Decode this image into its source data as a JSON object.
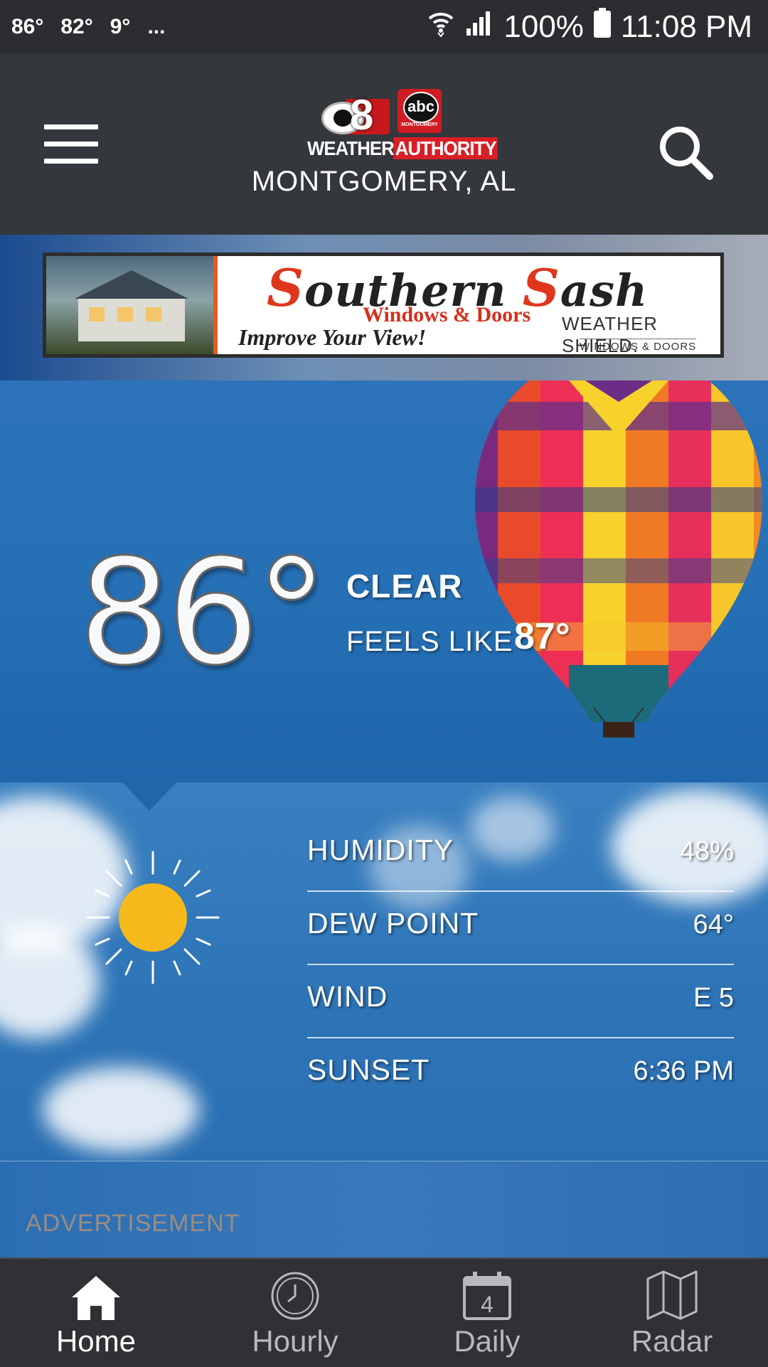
{
  "status_bar": {
    "notif_temps": [
      "86°",
      "82°",
      "9°"
    ],
    "more": "...",
    "battery": "100%",
    "time": "11:08 PM",
    "icons": [
      "wifi-icon",
      "signal-icon",
      "battery-icon"
    ]
  },
  "header": {
    "logo_station": "8",
    "logo_abc": "abc",
    "logo_abc_sub": "MONTGOMERY",
    "logo_weather": "WEATHER",
    "logo_authority": "AUTHORITY",
    "location": "MONTGOMERY, AL",
    "menu_icon": "hamburger-menu-icon",
    "search_icon": "search-icon"
  },
  "ad_banner": {
    "brand_s1": "S",
    "brand_w1": "outhern ",
    "brand_s2": "S",
    "brand_w2": "ash",
    "subtitle": "Windows & Doors",
    "tagline": "Improve Your View!",
    "partner": "WEATHER SHIELD.",
    "partner_sub": "WINDOWS & DOORS"
  },
  "current": {
    "temperature": "86°",
    "condition": "CLEAR",
    "feels_like_label": "FEELS LIKE",
    "feels_like_value": "87°",
    "icon": "sun-icon"
  },
  "details": [
    {
      "label": "HUMIDITY",
      "value": "48%"
    },
    {
      "label": "DEW POINT",
      "value": "64°"
    },
    {
      "label": "WIND",
      "value": "E 5"
    },
    {
      "label": "SUNSET",
      "value": "6:36 PM"
    }
  ],
  "advertisement_label": "ADVERTISEMENT",
  "bottom_nav": {
    "active": "Home",
    "items": [
      {
        "label": "Home",
        "icon": "home-icon"
      },
      {
        "label": "Hourly",
        "icon": "clock-icon"
      },
      {
        "label": "Daily",
        "icon": "calendar-icon",
        "badge": "4"
      },
      {
        "label": "Radar",
        "icon": "map-icon"
      }
    ]
  },
  "colors": {
    "header_bg": "#34373b",
    "sky_blue": "#2670b6",
    "sun": "#f6b91c",
    "brand_red": "#d91f26"
  }
}
